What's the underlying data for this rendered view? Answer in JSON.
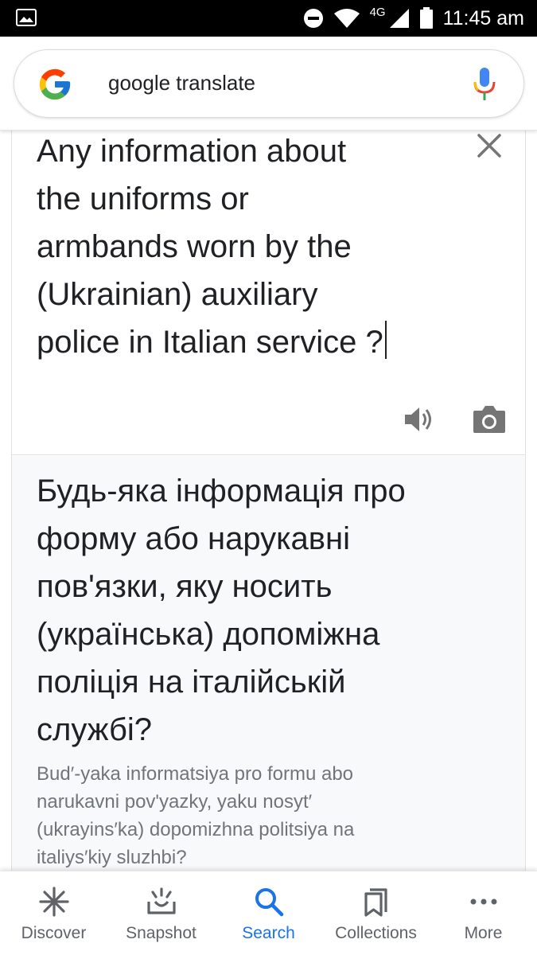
{
  "status_bar": {
    "network": "4G",
    "time": "11:45 am"
  },
  "search": {
    "query": "google translate"
  },
  "translator": {
    "source_text": "Any information about the uniforms or armbands worn by the (Ukrainian) auxiliary police in Italian service ?",
    "source_lines": [
      "Any information about",
      "the uniforms or",
      "armbands worn by the",
      "(Ukrainian) auxiliary",
      "police in Italian service ?"
    ],
    "translation_lines": [
      "Будь-яка інформація про",
      "форму або нарукавні",
      "пов'язки, яку носить",
      "(українська) допоміжна",
      "поліція на італійській",
      "службі?"
    ],
    "transliteration_lines": [
      "Bud′-yaka informatsiya pro formu abo",
      "narukavni pov'yazky, yaku nosyt′",
      "(ukrayins′ka) dopomizhna politsiya na",
      "italiys′kiy sluzhbi?"
    ]
  },
  "bottom_nav": {
    "items": [
      {
        "label": "Discover",
        "icon": "discover-asterisk-icon",
        "active": false
      },
      {
        "label": "Snapshot",
        "icon": "snapshot-tray-icon",
        "active": false
      },
      {
        "label": "Search",
        "icon": "search-magnifier-icon",
        "active": true
      },
      {
        "label": "Collections",
        "icon": "collections-bookmark-icon",
        "active": false
      },
      {
        "label": "More",
        "icon": "more-dots-icon",
        "active": false
      }
    ]
  },
  "colors": {
    "active": "#1a73e8",
    "inactive": "#5f6368",
    "text": "#202124",
    "secondary_text": "#70757a",
    "result_bg": "#f8f9fa"
  }
}
